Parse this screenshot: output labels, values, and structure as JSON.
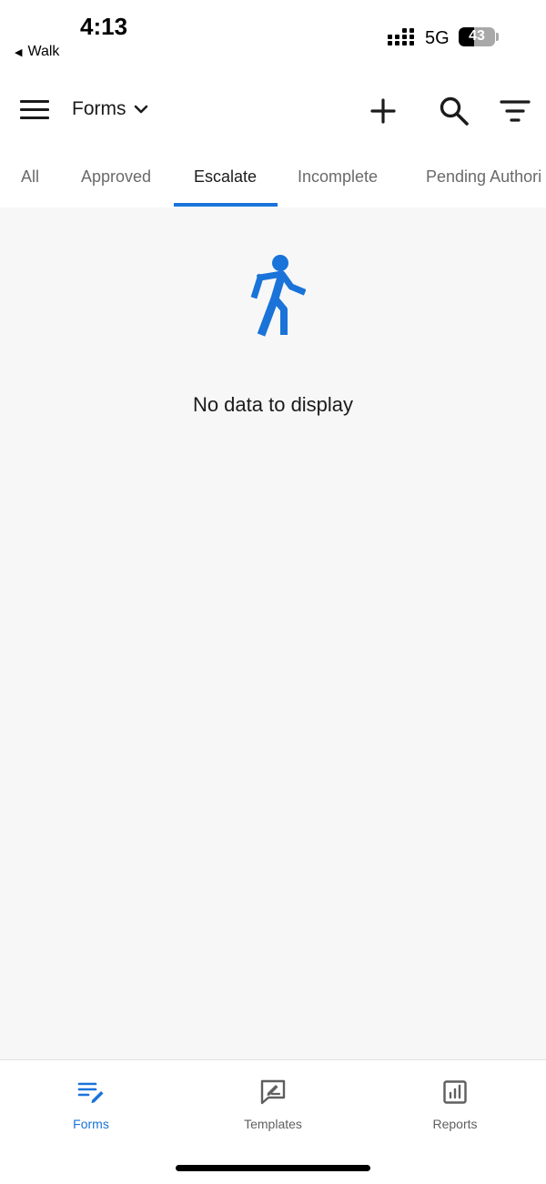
{
  "status_bar": {
    "time": "4:13",
    "back_app": "Walk",
    "network": "5G",
    "battery_pct": "43",
    "battery_level": 0.43
  },
  "app_bar": {
    "title": "Forms",
    "actions": [
      "add-icon",
      "search-icon",
      "filter-icon"
    ]
  },
  "tabs": {
    "items": [
      "All",
      "Approved",
      "Escalate",
      "Incomplete",
      "Pending Authori"
    ],
    "active": "Escalate"
  },
  "empty_state": {
    "icon": "walking-person-icon",
    "message": "No data to display"
  },
  "bottom_nav": {
    "items": [
      {
        "label": "Forms",
        "icon": "forms-icon",
        "active": true
      },
      {
        "label": "Templates",
        "icon": "templates-icon",
        "active": false
      },
      {
        "label": "Reports",
        "icon": "reports-icon",
        "active": false
      }
    ]
  },
  "colors": {
    "accent": "#1a73d9",
    "content_bg": "#f7f7f7",
    "text": "#1b1b1b",
    "muted": "#6a6a6a"
  }
}
